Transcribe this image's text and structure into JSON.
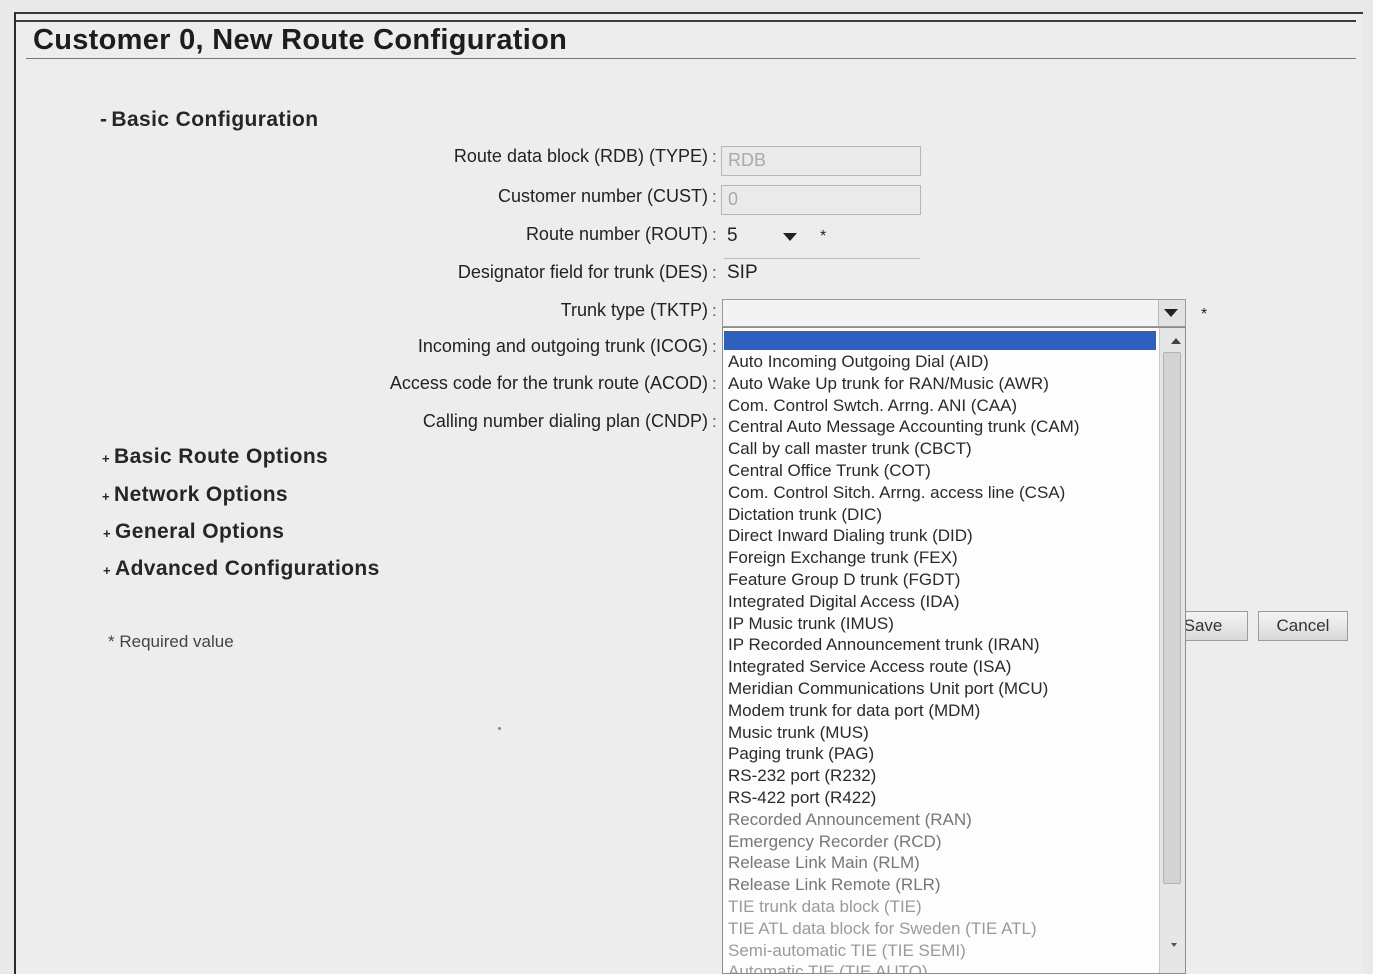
{
  "page": {
    "title": "Customer 0, New Route Configuration"
  },
  "sections": {
    "basic_configuration": "Basic Configuration",
    "basic_configuration_marker": "-",
    "collapsed_marker": "+",
    "basic_route_options": "Basic Route Options",
    "network_options": "Network Options",
    "general_options": "General Options",
    "advanced_configurations": "Advanced Configurations"
  },
  "fields": {
    "rdb_label": "Route data block (RDB) (TYPE)",
    "rdb_value": "RDB",
    "cust_label": "Customer number (CUST)",
    "cust_value": "0",
    "rout_label": "Route number (ROUT)",
    "rout_value": "5",
    "des_label": "Designator field for trunk (DES)",
    "des_value": "SIP",
    "tktp_label": "Trunk type (TKTP)",
    "tktp_value": "",
    "icog_label": "Incoming and outgoing trunk  (ICOG)",
    "acod_label": "Access code for the trunk route (ACOD)",
    "cndp_label": "Calling number dialing plan (CNDP)",
    "colon": ":"
  },
  "trunk_type_options": [
    "Auto Incoming Outgoing Dial (AID)",
    "Auto Wake Up trunk for RAN/Music (AWR)",
    "Com. Control Swtch. Arrng. ANI (CAA)",
    "Central Auto Message Accounting trunk (CAM)",
    "Call by call master trunk (CBCT)",
    "Central Office Trunk (COT)",
    "Com. Control Sitch. Arrng. access line (CSA)",
    "Dictation trunk (DIC)",
    "Direct Inward Dialing trunk (DID)",
    "Foreign Exchange trunk (FEX)",
    "Feature Group D trunk (FGDT)",
    "Integrated Digital Access (IDA)",
    "IP Music trunk (IMUS)",
    "IP Recorded Announcement trunk (IRAN)",
    "Integrated Service Access route  (ISA)",
    "Meridian Communications Unit port (MCU)",
    "Modem trunk for data port (MDM)",
    "Music trunk (MUS)",
    "Paging trunk (PAG)",
    "RS-232 port (R232)",
    "RS-422 port (R422)",
    "Recorded Announcement (RAN)",
    "Emergency Recorder (RCD)",
    "Release Link Main (RLM)",
    "Release Link Remote (RLR)",
    "TIE trunk data block (TIE)",
    "TIE ATL data block for Sweden (TIE ATL)",
    "Semi-automatic TIE (TIE SEMI)",
    "Automatic TIE (TIE AUTO)"
  ],
  "buttons": {
    "save": "Save",
    "cancel": "Cancel"
  },
  "footer": {
    "required_note": "* Required value"
  },
  "required_marker": "*"
}
